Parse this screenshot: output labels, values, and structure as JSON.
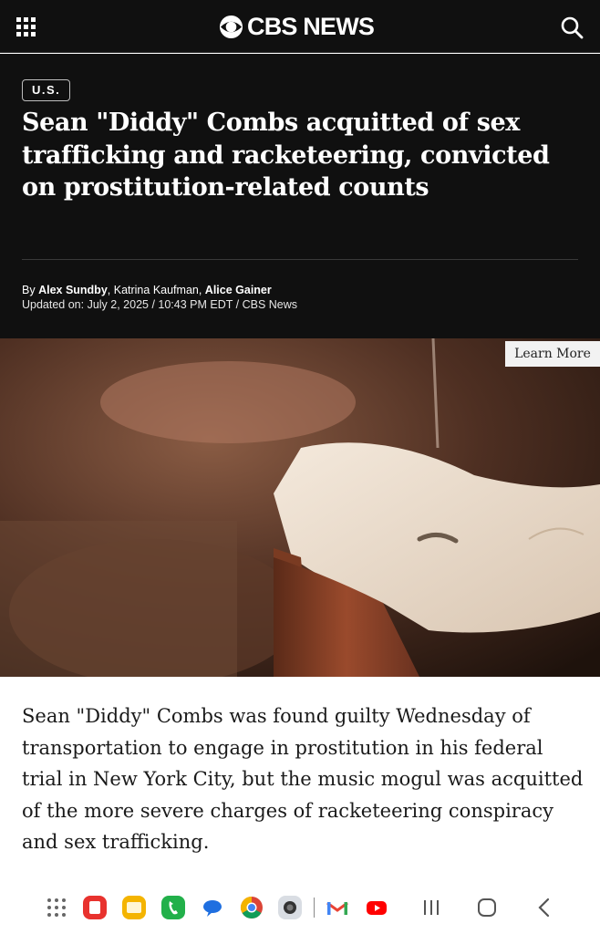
{
  "topbar": {
    "brand": "CBS NEWS",
    "menu_icon": "grid-menu-icon",
    "search_icon": "search-icon"
  },
  "article": {
    "section": "U.S.",
    "headline": "Sean \"Diddy\" Combs acquitted of sex trafficking and racketeering, convicted on prostitution-related counts",
    "byline_prefix": "By ",
    "authors": [
      "Alex Sundby",
      "Katrina Kaufman",
      "Alice Gainer"
    ],
    "updated": "Updated on: July 2, 2025 / 10:43 PM EDT / CBS News",
    "ad_label": "Learn More",
    "body": "Sean \"Diddy\" Combs was found guilty Wednesday of transportation to engage in prostitution in his federal trial in New York City, but the music mogul was acquitted of the more severe charges of racketeering conspiracy and sex trafficking."
  },
  "dock": {
    "apps": [
      "app-drawer-icon",
      "notes-app-icon",
      "files-app-icon",
      "phone-app-icon",
      "messages-app-icon",
      "chrome-app-icon",
      "camera-app-icon",
      "gmail-app-icon",
      "youtube-app-icon"
    ],
    "system_buttons": [
      "recents-button",
      "home-button",
      "back-button"
    ]
  },
  "colors": {
    "header_bg": "#101010",
    "text_light": "#ffffff",
    "body_text": "#1a1a1a"
  }
}
